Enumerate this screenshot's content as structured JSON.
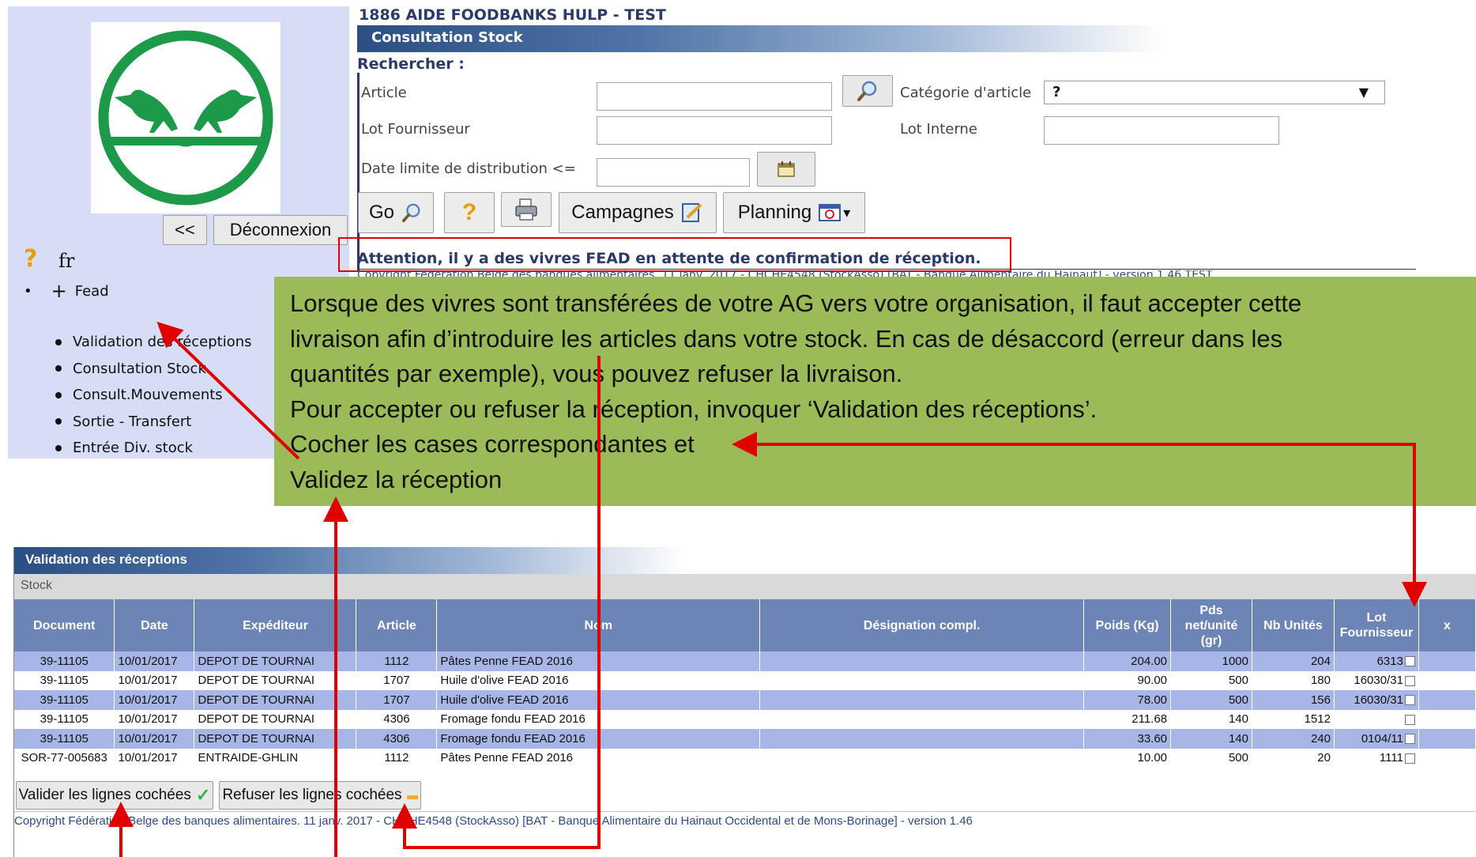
{
  "sidebar": {
    "collapse_label": "<<",
    "logout_label": "Déconnexion",
    "help_glyph": "?",
    "language": "fr",
    "group_toggle": "+",
    "group_label": "Fead",
    "items": [
      {
        "label": "Validation des réceptions"
      },
      {
        "label": "Consultation Stock"
      },
      {
        "label": "Consult.Mouvements"
      },
      {
        "label": "Sortie - Transfert"
      },
      {
        "label": "Entrée Div. stock"
      }
    ]
  },
  "header": {
    "org_title": "1886 AIDE FOODBANKS HULP - TEST",
    "section_title": "Consultation Stock"
  },
  "search": {
    "title": "Rechercher :",
    "article_label": "Article",
    "article_value": "",
    "category_label": "Catégorie d'article",
    "category_value": "?",
    "lot_supplier_label": "Lot Fournisseur",
    "lot_supplier_value": "",
    "lot_internal_label": "Lot Interne",
    "lot_internal_value": "",
    "date_limit_label": "Date limite de distribution <=",
    "date_limit_value": ""
  },
  "toolbar": {
    "go_label": "Go",
    "help_glyph": "?",
    "campaigns_label": "Campagnes",
    "planning_label": "Planning",
    "planning_caret": "▾"
  },
  "notice": {
    "attention": "Attention, il y a des vivres FEAD en attente de confirmation de réception.",
    "faint_line": "Copyright Fédération Belge des banques alimentaires. 11 janv. 2017 - CHCHE4548 (StockAsso) [BAT - Banque Alimentaire du Hainaut] - version 1.46 TEST"
  },
  "note": {
    "lines": [
      "Lorsque des vivres sont transférées de votre AG vers votre organisation, il faut accepter cette",
      "livraison afin d’introduire les articles dans votre stock. En cas de désaccord (erreur dans les",
      "quantités par exemple), vous pouvez refuser la livraison.",
      "Pour accepter ou refuser la réception, invoquer ‘Validation des réceptions’.",
      "Cocher les cases correspondantes et",
      "Validez la réception"
    ]
  },
  "validation": {
    "title": "Validation des réceptions",
    "subtitle": "Stock",
    "columns": [
      "Document",
      "Date",
      "Expéditeur",
      "Article",
      "Nom",
      "Désignation compl.",
      "Poids (Kg)",
      "Pds net/unité (gr)",
      "Nb Unités",
      "Lot Fournisseur",
      "x"
    ],
    "rows": [
      {
        "document": "39-11105",
        "date": "10/01/2017",
        "sender": "DEPOT DE TOURNAI",
        "article": "1112",
        "name": "Pâtes Penne FEAD 2016",
        "designation": "",
        "weight": "204.00",
        "net_per_unit": "1000",
        "units": "204",
        "lot": "6313"
      },
      {
        "document": "39-11105",
        "date": "10/01/2017",
        "sender": "DEPOT DE TOURNAI",
        "article": "1707",
        "name": "Huile d'olive FEAD 2016",
        "designation": "",
        "weight": "90.00",
        "net_per_unit": "500",
        "units": "180",
        "lot": "16030/31"
      },
      {
        "document": "39-11105",
        "date": "10/01/2017",
        "sender": "DEPOT DE TOURNAI",
        "article": "1707",
        "name": "Huile d'olive FEAD 2016",
        "designation": "",
        "weight": "78.00",
        "net_per_unit": "500",
        "units": "156",
        "lot": "16030/31"
      },
      {
        "document": "39-11105",
        "date": "10/01/2017",
        "sender": "DEPOT DE TOURNAI",
        "article": "4306",
        "name": "Fromage fondu FEAD 2016",
        "designation": "",
        "weight": "211.68",
        "net_per_unit": "140",
        "units": "1512",
        "lot": ""
      },
      {
        "document": "39-11105",
        "date": "10/01/2017",
        "sender": "DEPOT DE TOURNAI",
        "article": "4306",
        "name": "Fromage fondu FEAD 2016",
        "designation": "",
        "weight": "33.60",
        "net_per_unit": "140",
        "units": "240",
        "lot": "0104/11"
      },
      {
        "document": "SOR-77-005683",
        "date": "10/01/2017",
        "sender": "ENTRAIDE-GHLIN",
        "article": "1112",
        "name": "Pâtes Penne FEAD 2016",
        "designation": "",
        "weight": "10.00",
        "net_per_unit": "500",
        "units": "20",
        "lot": "1111"
      }
    ],
    "validate_label": "Valider les lignes cochées",
    "refuse_label": "Refuser les lignes cochées",
    "copyright": "Copyright Fédération Belge des banques alimentaires. 11 janv. 2017 - CHCHE4548 (StockAsso) [BAT - Banque Alimentaire du Hainaut Occidental et de Mons-Borinage] - version 1.46"
  },
  "colors": {
    "note_bg": "#9bbb59",
    "arrow": "#e00000",
    "header_bar": "#2a4f82",
    "table_header": "#6c85b6",
    "row_highlight": "#a7b6e6",
    "sidebar_bg": "#d6ddf5",
    "logo_green": "#1c9a49"
  }
}
